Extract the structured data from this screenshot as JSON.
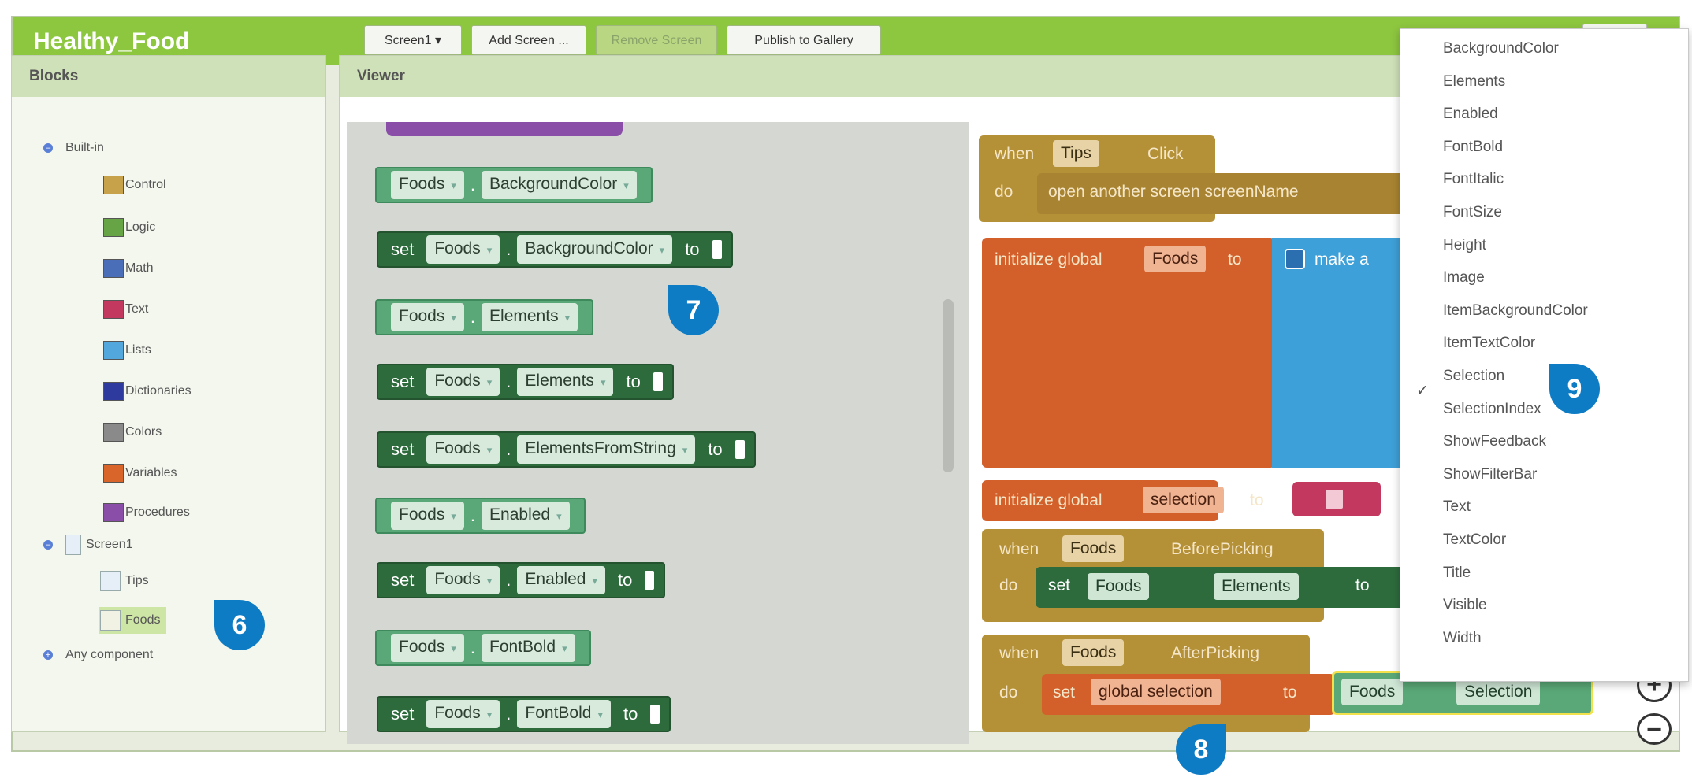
{
  "app": {
    "title": "Healthy_Food"
  },
  "toolbar": {
    "screen_select": "Screen1 ▾",
    "add_screen": "Add Screen ...",
    "remove_screen": "Remove Screen",
    "publish": "Publish to Gallery"
  },
  "blocks_panel": {
    "header": "Blocks",
    "builtin_label": "Built-in",
    "builtin_items": [
      {
        "label": "Control",
        "color": "#c7a24a"
      },
      {
        "label": "Logic",
        "color": "#66a445"
      },
      {
        "label": "Math",
        "color": "#4a6fb8"
      },
      {
        "label": "Text",
        "color": "#c2385e"
      },
      {
        "label": "Lists",
        "color": "#52a7dd"
      },
      {
        "label": "Dictionaries",
        "color": "#2e3a9e"
      },
      {
        "label": "Colors",
        "color": "#8a8a8a"
      },
      {
        "label": "Variables",
        "color": "#d9652a"
      },
      {
        "label": "Procedures",
        "color": "#8a4ea8"
      }
    ],
    "screen_label": "Screen1",
    "components": [
      "Tips",
      "Foods"
    ],
    "any_component_label": "Any component"
  },
  "viewer": {
    "header": "Viewer",
    "flyout": [
      {
        "kind": "getter",
        "component": "Foods",
        "property": "BackgroundColor"
      },
      {
        "kind": "setter",
        "set_word": "set",
        "component": "Foods",
        "property": "BackgroundColor",
        "to_word": "to"
      },
      {
        "kind": "getter",
        "component": "Foods",
        "property": "Elements"
      },
      {
        "kind": "setter",
        "set_word": "set",
        "component": "Foods",
        "property": "Elements",
        "to_word": "to"
      },
      {
        "kind": "setter",
        "set_word": "set",
        "component": "Foods",
        "property": "ElementsFromString",
        "to_word": "to"
      },
      {
        "kind": "getter",
        "component": "Foods",
        "property": "Enabled"
      },
      {
        "kind": "setter",
        "set_word": "set",
        "component": "Foods",
        "property": "Enabled",
        "to_word": "to"
      },
      {
        "kind": "getter",
        "component": "Foods",
        "property": "FontBold"
      },
      {
        "kind": "setter",
        "set_word": "set",
        "component": "Foods",
        "property": "FontBold",
        "to_word": "to"
      }
    ],
    "workspace": {
      "tips_click": {
        "when": "when",
        "component": "Tips",
        "event": "Click",
        "do": "do",
        "action": "open another screen  screenName"
      },
      "init_foods": {
        "label": "initialize global",
        "name": "Foods",
        "to": "to",
        "make": "make a"
      },
      "init_selection": {
        "label": "initialize global",
        "name": "selection",
        "to": "to"
      },
      "before_picking": {
        "when": "when",
        "component": "Foods",
        "event": "BeforePicking",
        "do": "do",
        "set": "set",
        "target_component": "Foods",
        "property": "Elements",
        "to": "to"
      },
      "after_picking": {
        "when": "when",
        "component": "Foods",
        "event": "AfterPicking",
        "do": "do",
        "set": "set",
        "variable": "global selection",
        "to": "to",
        "value_component": "Foods",
        "value_property": "Selection"
      }
    }
  },
  "property_dropdown": {
    "items": [
      "BackgroundColor",
      "Elements",
      "Enabled",
      "FontBold",
      "FontItalic",
      "FontSize",
      "Height",
      "Image",
      "ItemBackgroundColor",
      "ItemTextColor",
      "Selection",
      "SelectionIndex",
      "ShowFeedback",
      "ShowFilterBar",
      "Text",
      "TextColor",
      "Title",
      "Visible",
      "Width"
    ],
    "checked_item": "Selection",
    "check_mark": "✓"
  },
  "zoom": {
    "in": "+",
    "out": "−"
  },
  "callouts": {
    "six": "6",
    "seven": "7",
    "eight": "8",
    "nine": "9"
  },
  "colors": {
    "accent_green": "#8dc63f",
    "callout_blue": "#0e7cc4",
    "getter_green": "#5aa877",
    "setter_green": "#2d6b3c",
    "event_gold": "#b49036",
    "variable_orange": "#d35f2b",
    "list_blue": "#3ea0d8"
  }
}
